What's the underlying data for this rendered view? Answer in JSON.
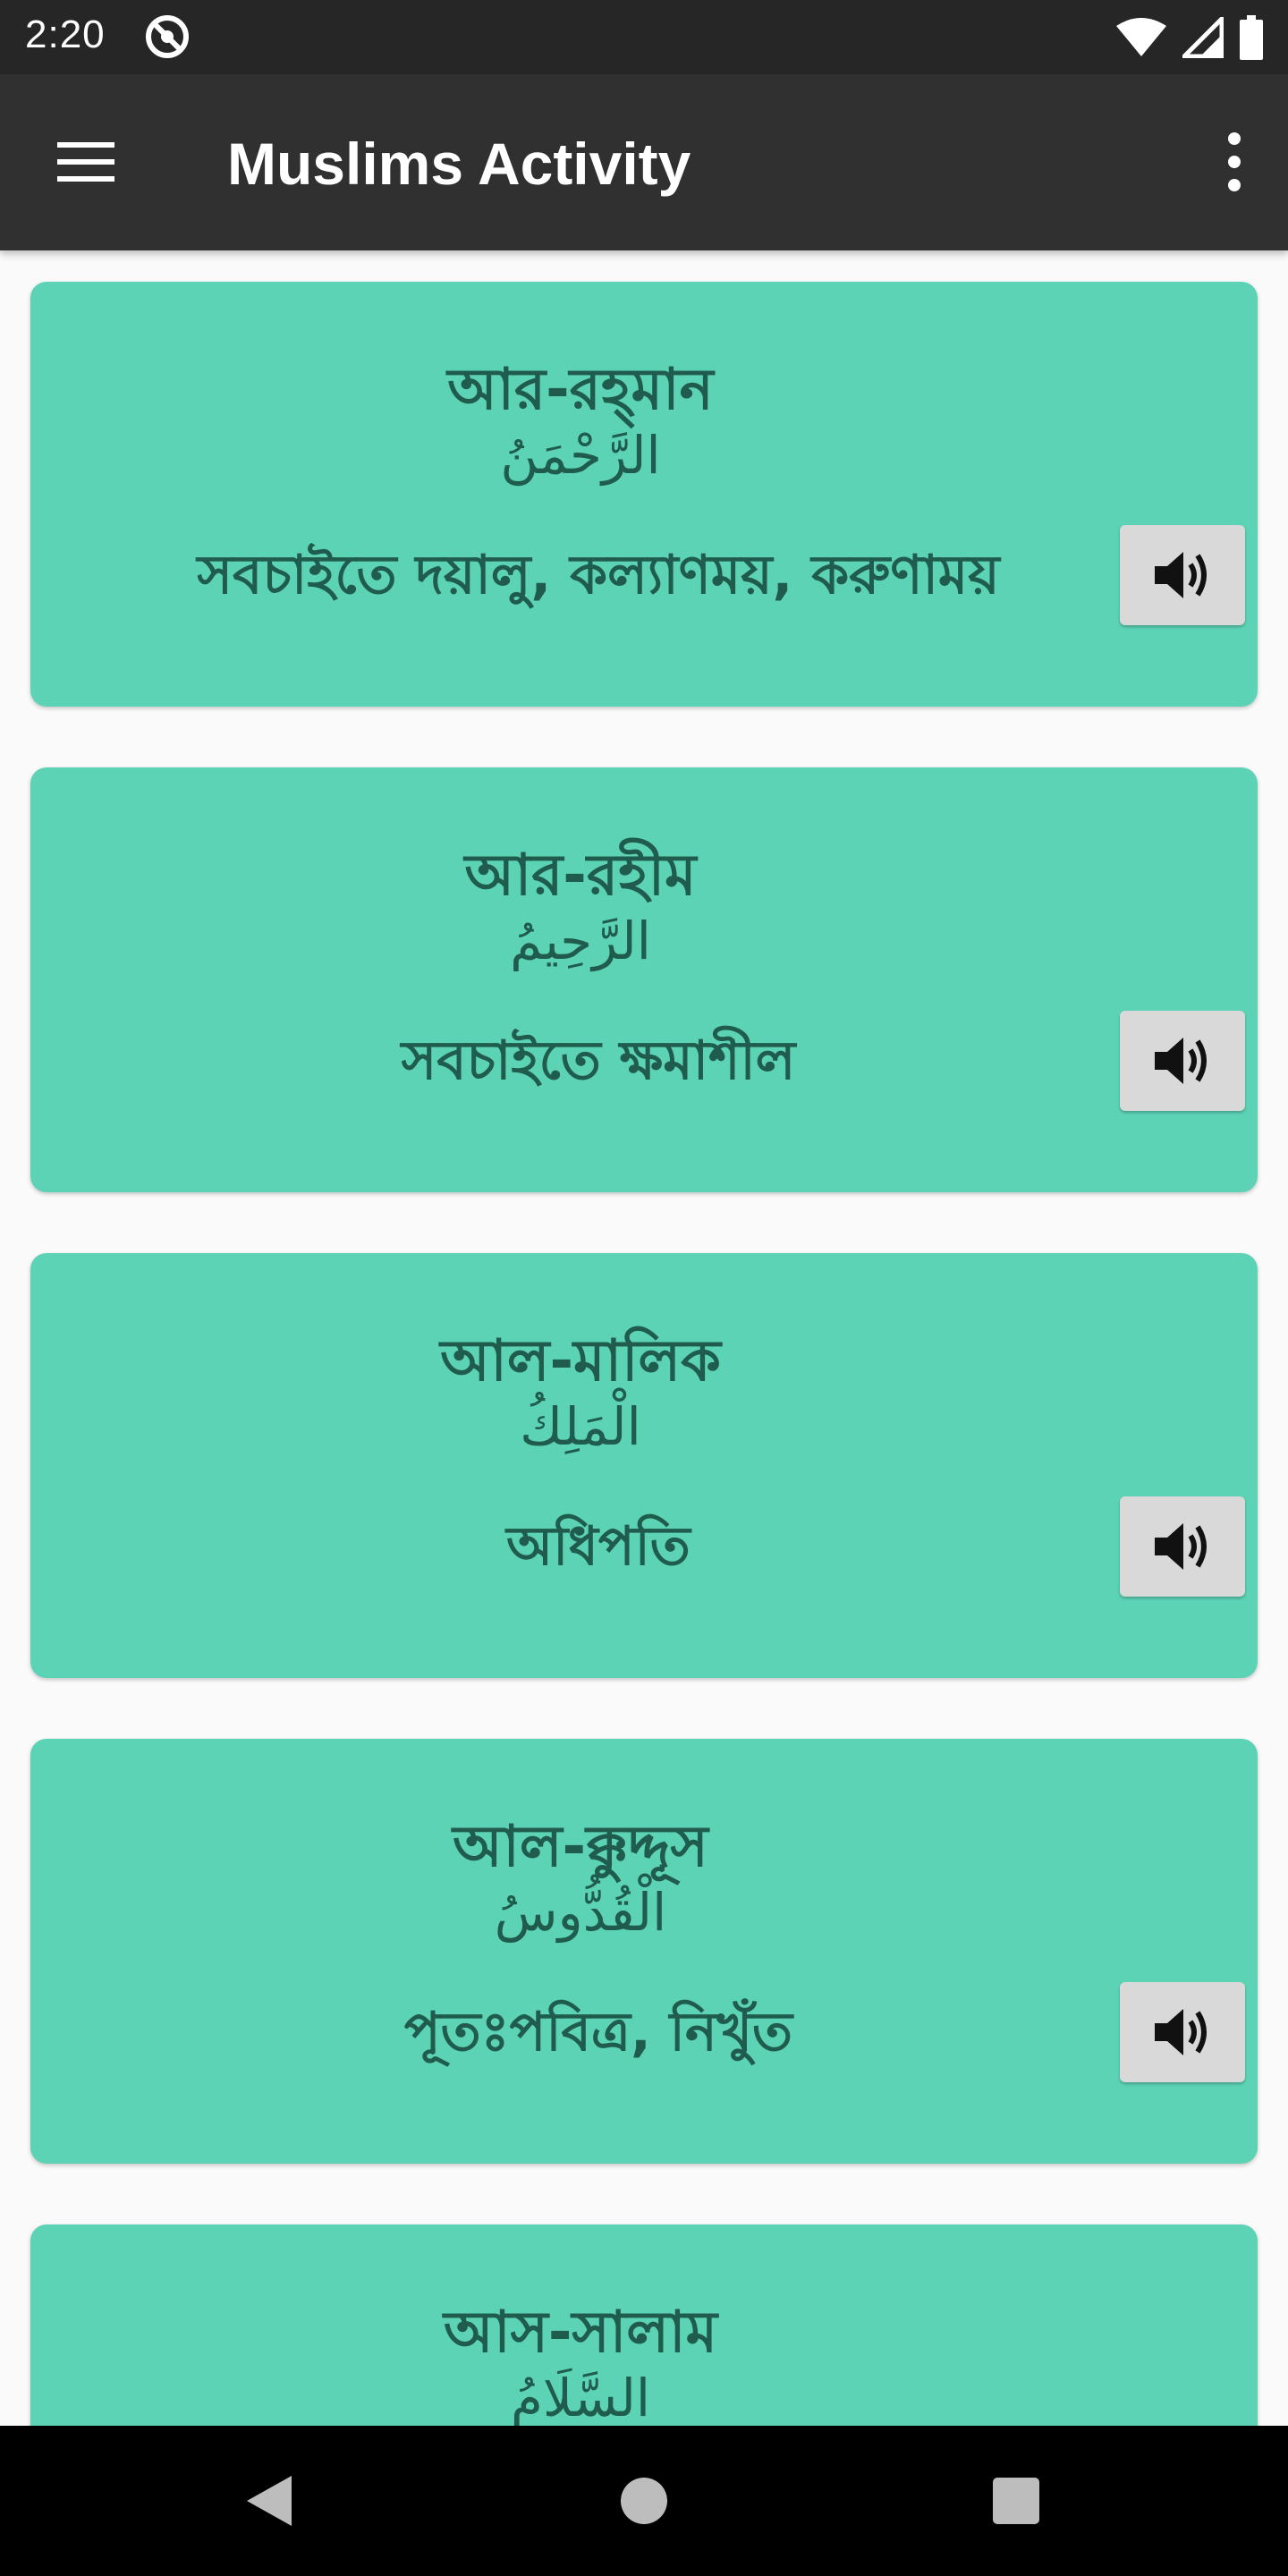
{
  "status_bar": {
    "time": "2:20"
  },
  "app_bar": {
    "title": "Muslims Activity"
  },
  "names": [
    {
      "title": "আর-রহ্‌মান",
      "arabic": "الرَّحْمَنُ",
      "meaning": "সবচাইতে দয়ালু, কল্যাণময়, করুণাময়"
    },
    {
      "title": "আর-রহীম",
      "arabic": "الرَّحِيمُ",
      "meaning": "সবচাইতে ক্ষমাশীল"
    },
    {
      "title": "আল-মালিক",
      "arabic": "الْمَلِكُ",
      "meaning": "অধিপতি"
    },
    {
      "title": "আল-ক্কুদ্দূস",
      "arabic": "الْقُدُّوسُ",
      "meaning": "পূতঃপবিত্র, নিখুঁত"
    },
    {
      "title": "আস-সালাম",
      "arabic": "السَّلَامُ",
      "meaning": ""
    }
  ]
}
